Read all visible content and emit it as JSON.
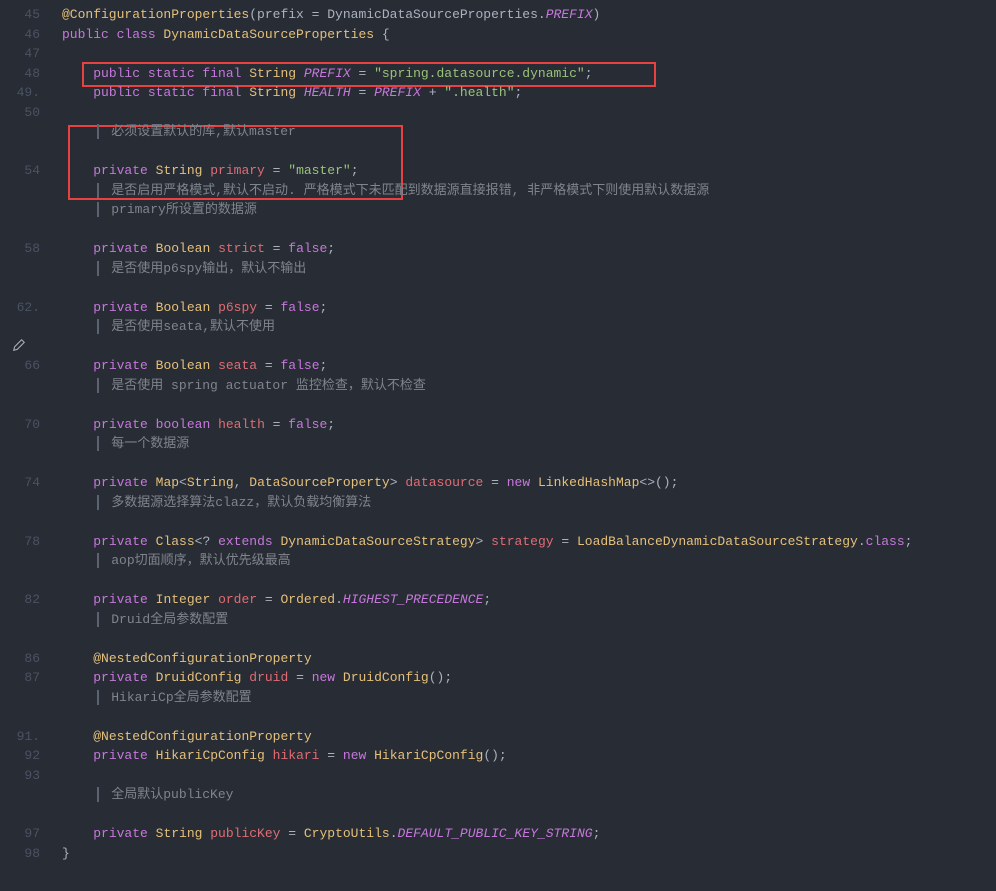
{
  "gutter": [
    "45",
    "46",
    "47",
    "48",
    "49.",
    "50",
    "",
    "",
    "54",
    "",
    "",
    "",
    "58",
    "",
    "",
    "62.",
    "",
    "",
    "66",
    "",
    "",
    "70",
    "",
    "",
    "74",
    "",
    "",
    "78",
    "",
    "",
    "82",
    "",
    "",
    "86",
    "87",
    "",
    "",
    "91.",
    "92",
    "93",
    "",
    "",
    "97",
    "98"
  ],
  "l45": {
    "anno": "@ConfigurationProperties",
    "pfx": "(prefix = DynamicDataSourceProperties.",
    "field": "PREFIX",
    "end": ")"
  },
  "l46": {
    "k1": "public ",
    "k2": "class ",
    "t": "DynamicDataSourceProperties ",
    "b": "{"
  },
  "l48": {
    "k": "public static final ",
    "t": "String ",
    "v": "PREFIX",
    "eq": " = ",
    "s": "\"spring.datasource.dynamic\"",
    "sc": ";"
  },
  "l49": {
    "k": "public static final ",
    "t": "String ",
    "v": "HEALTH",
    "eq": " = ",
    "ref": "PREFIX",
    "plus": " + ",
    "s": "\".health\"",
    "sc": ";"
  },
  "c1": "必须设置默认的库,默认master",
  "l54": {
    "k": "private ",
    "t": "String ",
    "v": "primary",
    "eq": " = ",
    "s": "\"master\"",
    "sc": ";"
  },
  "c2a": "是否启用严格模式,默认不启动. 严格模式下未匹配到数据源直接报错, 非严格模式下则使用默认数据源",
  "c2b": "primary所设置的数据源",
  "l58": {
    "k": "private ",
    "t": "Boolean ",
    "v": "strict",
    "eq": " = ",
    "val": "false",
    "sc": ";"
  },
  "c3": "是否使用p6spy输出，默认不输出",
  "l62": {
    "k": "private ",
    "t": "Boolean ",
    "v": "p6spy",
    "eq": " = ",
    "val": "false",
    "sc": ";"
  },
  "c4": "是否使用seata,默认不使用",
  "l66": {
    "k": "private ",
    "t": "Boolean ",
    "v": "seata",
    "eq": " = ",
    "val": "false",
    "sc": ";"
  },
  "c5": "是否使用 spring actuator 监控检查，默认不检查",
  "l70": {
    "k": "private ",
    "k2": "boolean ",
    "v": "health",
    "eq": " = ",
    "val": "false",
    "sc": ";"
  },
  "c6": "每一个数据源",
  "l74": {
    "k": "private ",
    "t": "Map",
    "g1": "<",
    "t2": "String",
    "c": ", ",
    "t3": "DataSourceProperty",
    "g2": "> ",
    "v": "datasource",
    "eq": " = ",
    "n": "new ",
    "t4": "LinkedHashMap",
    "g3": "<>();"
  },
  "c7": "多数据源选择算法clazz，默认负载均衡算法",
  "l78": {
    "k": "private ",
    "t": "Class",
    "g1": "<? ",
    "k2": "extends ",
    "t2": "DynamicDataSourceStrategy",
    "g2": "> ",
    "v": "strategy",
    "eq": " = ",
    "t3": "LoadBalanceDynamicDataSourceStrategy",
    "dot": ".",
    "cls": "class",
    "sc": ";"
  },
  "c8": "aop切面顺序，默认优先级最高",
  "l82": {
    "k": "private ",
    "t": "Integer ",
    "v": "order",
    "eq": " = ",
    "t2": "Ordered",
    "dot": ".",
    "f": "HIGHEST_PRECEDENCE",
    "sc": ";"
  },
  "c9": "Druid全局参数配置",
  "l86": "@NestedConfigurationProperty",
  "l87": {
    "k": "private ",
    "t": "DruidConfig ",
    "v": "druid",
    "eq": " = ",
    "n": "new ",
    "t2": "DruidConfig",
    "p": "();"
  },
  "c10": "HikariCp全局参数配置",
  "l91": "@NestedConfigurationProperty",
  "l92": {
    "k": "private ",
    "t": "HikariCpConfig ",
    "v": "hikari",
    "eq": " = ",
    "n": "new ",
    "t2": "HikariCpConfig",
    "p": "();"
  },
  "c11": "全局默认publicKey",
  "l97": {
    "k": "private ",
    "t": "String ",
    "v": "publicKey",
    "eq": " = ",
    "t2": "CryptoUtils",
    "dot": ".",
    "f": "DEFAULT_PUBLIC_KEY_STRING",
    "sc": ";"
  },
  "l98": "}"
}
